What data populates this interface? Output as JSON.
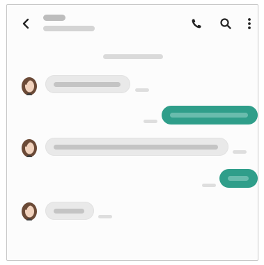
{
  "header": {
    "back_icon": "chevron-left-icon",
    "contact_name": "",
    "contact_subtitle": "",
    "actions": [
      {
        "name": "call-icon"
      },
      {
        "name": "search-icon"
      },
      {
        "name": "more-vertical-icon"
      }
    ]
  },
  "date_separator": "",
  "messages": [
    {
      "direction": "incoming",
      "text": "",
      "time": ""
    },
    {
      "direction": "outgoing",
      "text": "",
      "time": ""
    },
    {
      "direction": "incoming",
      "text": "",
      "time": ""
    },
    {
      "direction": "outgoing",
      "text": "",
      "time": ""
    },
    {
      "direction": "incoming",
      "text": "",
      "time": ""
    }
  ],
  "colors": {
    "outgoing_bubble": "#2f9e8a",
    "incoming_bubble": "#e9e9e9",
    "icon": "#222222"
  }
}
